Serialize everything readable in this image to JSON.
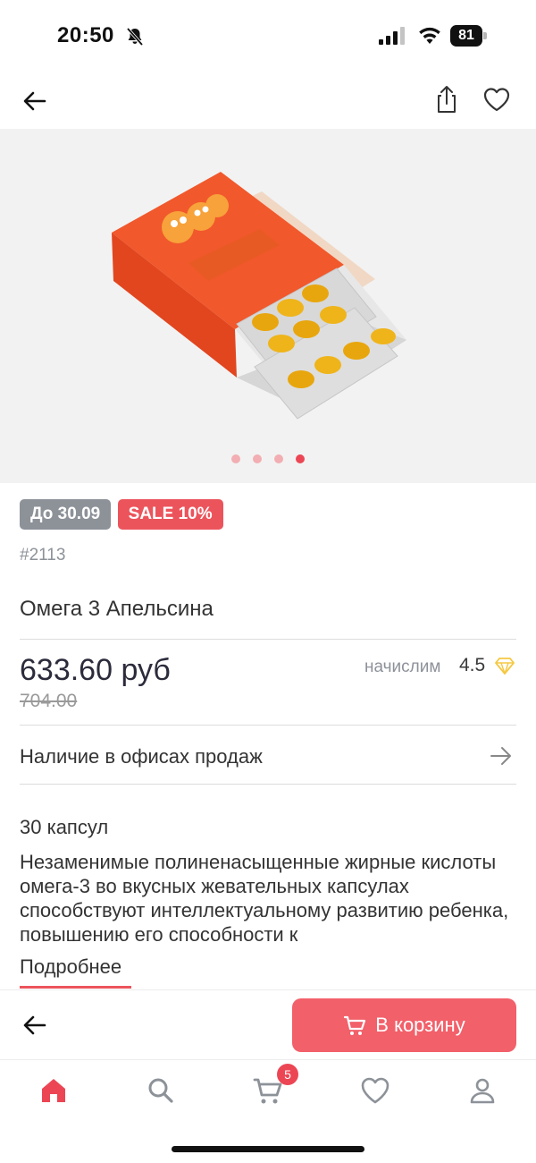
{
  "status_bar": {
    "time": "20:50",
    "battery": "81"
  },
  "gallery": {
    "slides_total": 4,
    "active_slide": 4
  },
  "product": {
    "badge_date": "До 30.09",
    "badge_sale": "SALE 10%",
    "sku": "#2113",
    "title": "Омега 3 Апельсина",
    "price": "633.60 руб",
    "old_price": "704.00",
    "bonus_label": "начислим",
    "bonus_value": "4.5",
    "availability_label": "Наличие в офисах продаж",
    "capsules": "30 капсул",
    "description": "Незаменимые полиненасыщенные жирные кислоты омега-3 во вкусных жевательных капсулах способствуют интеллектуальному развитию ребенка, повышению его способности к",
    "more_label": "Подробнее"
  },
  "action_bar": {
    "cart_button_label": "В корзину"
  },
  "tab_bar": {
    "cart_count": "5"
  },
  "colors": {
    "accent": "#f2606a",
    "sale": "#ec545c",
    "gray_badge": "#8d9299",
    "diamond": "#f5c842"
  },
  "icons": [
    "bell-slash-icon",
    "signal-icon",
    "wifi-icon",
    "back-arrow-icon",
    "share-icon",
    "heart-icon",
    "diamond-icon",
    "arrow-right-icon",
    "cart-icon",
    "home-icon",
    "search-icon",
    "user-icon"
  ]
}
